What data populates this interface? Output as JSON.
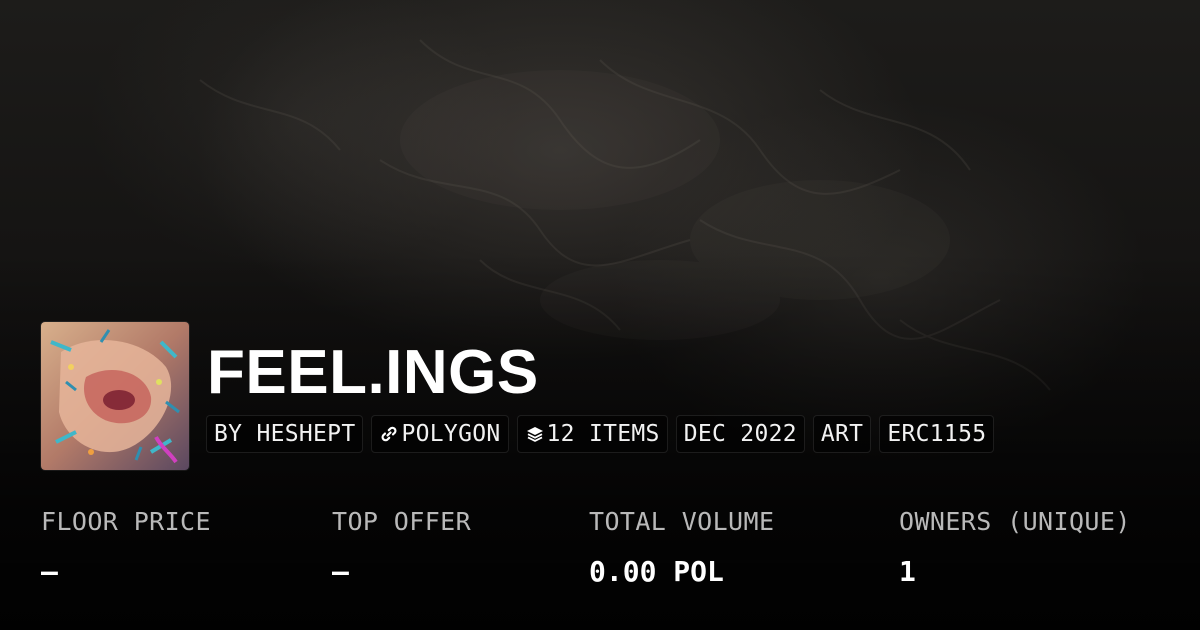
{
  "collection": {
    "title": "FEEL.INGS",
    "thumbnail_icon": "collection-artwork-thumbnail"
  },
  "tags": [
    {
      "label": "BY HESHEPT"
    },
    {
      "label": "POLYGON",
      "icon": "chain-link-icon"
    },
    {
      "label": "12 ITEMS",
      "icon": "layers-icon"
    },
    {
      "label": "DEC 2022"
    },
    {
      "label": "ART"
    },
    {
      "label": "ERC1155"
    }
  ],
  "stats": [
    {
      "label": "FLOOR PRICE",
      "value": "–"
    },
    {
      "label": "TOP OFFER",
      "value": "–"
    },
    {
      "label": "TOTAL VOLUME",
      "value": "0.00 POL"
    },
    {
      "label": "OWNERS (UNIQUE)",
      "value": "1"
    }
  ],
  "colors": {
    "background": "#141312",
    "text_primary": "#ffffff",
    "text_secondary": "#b9b9b9",
    "tag_background": "#000000"
  }
}
